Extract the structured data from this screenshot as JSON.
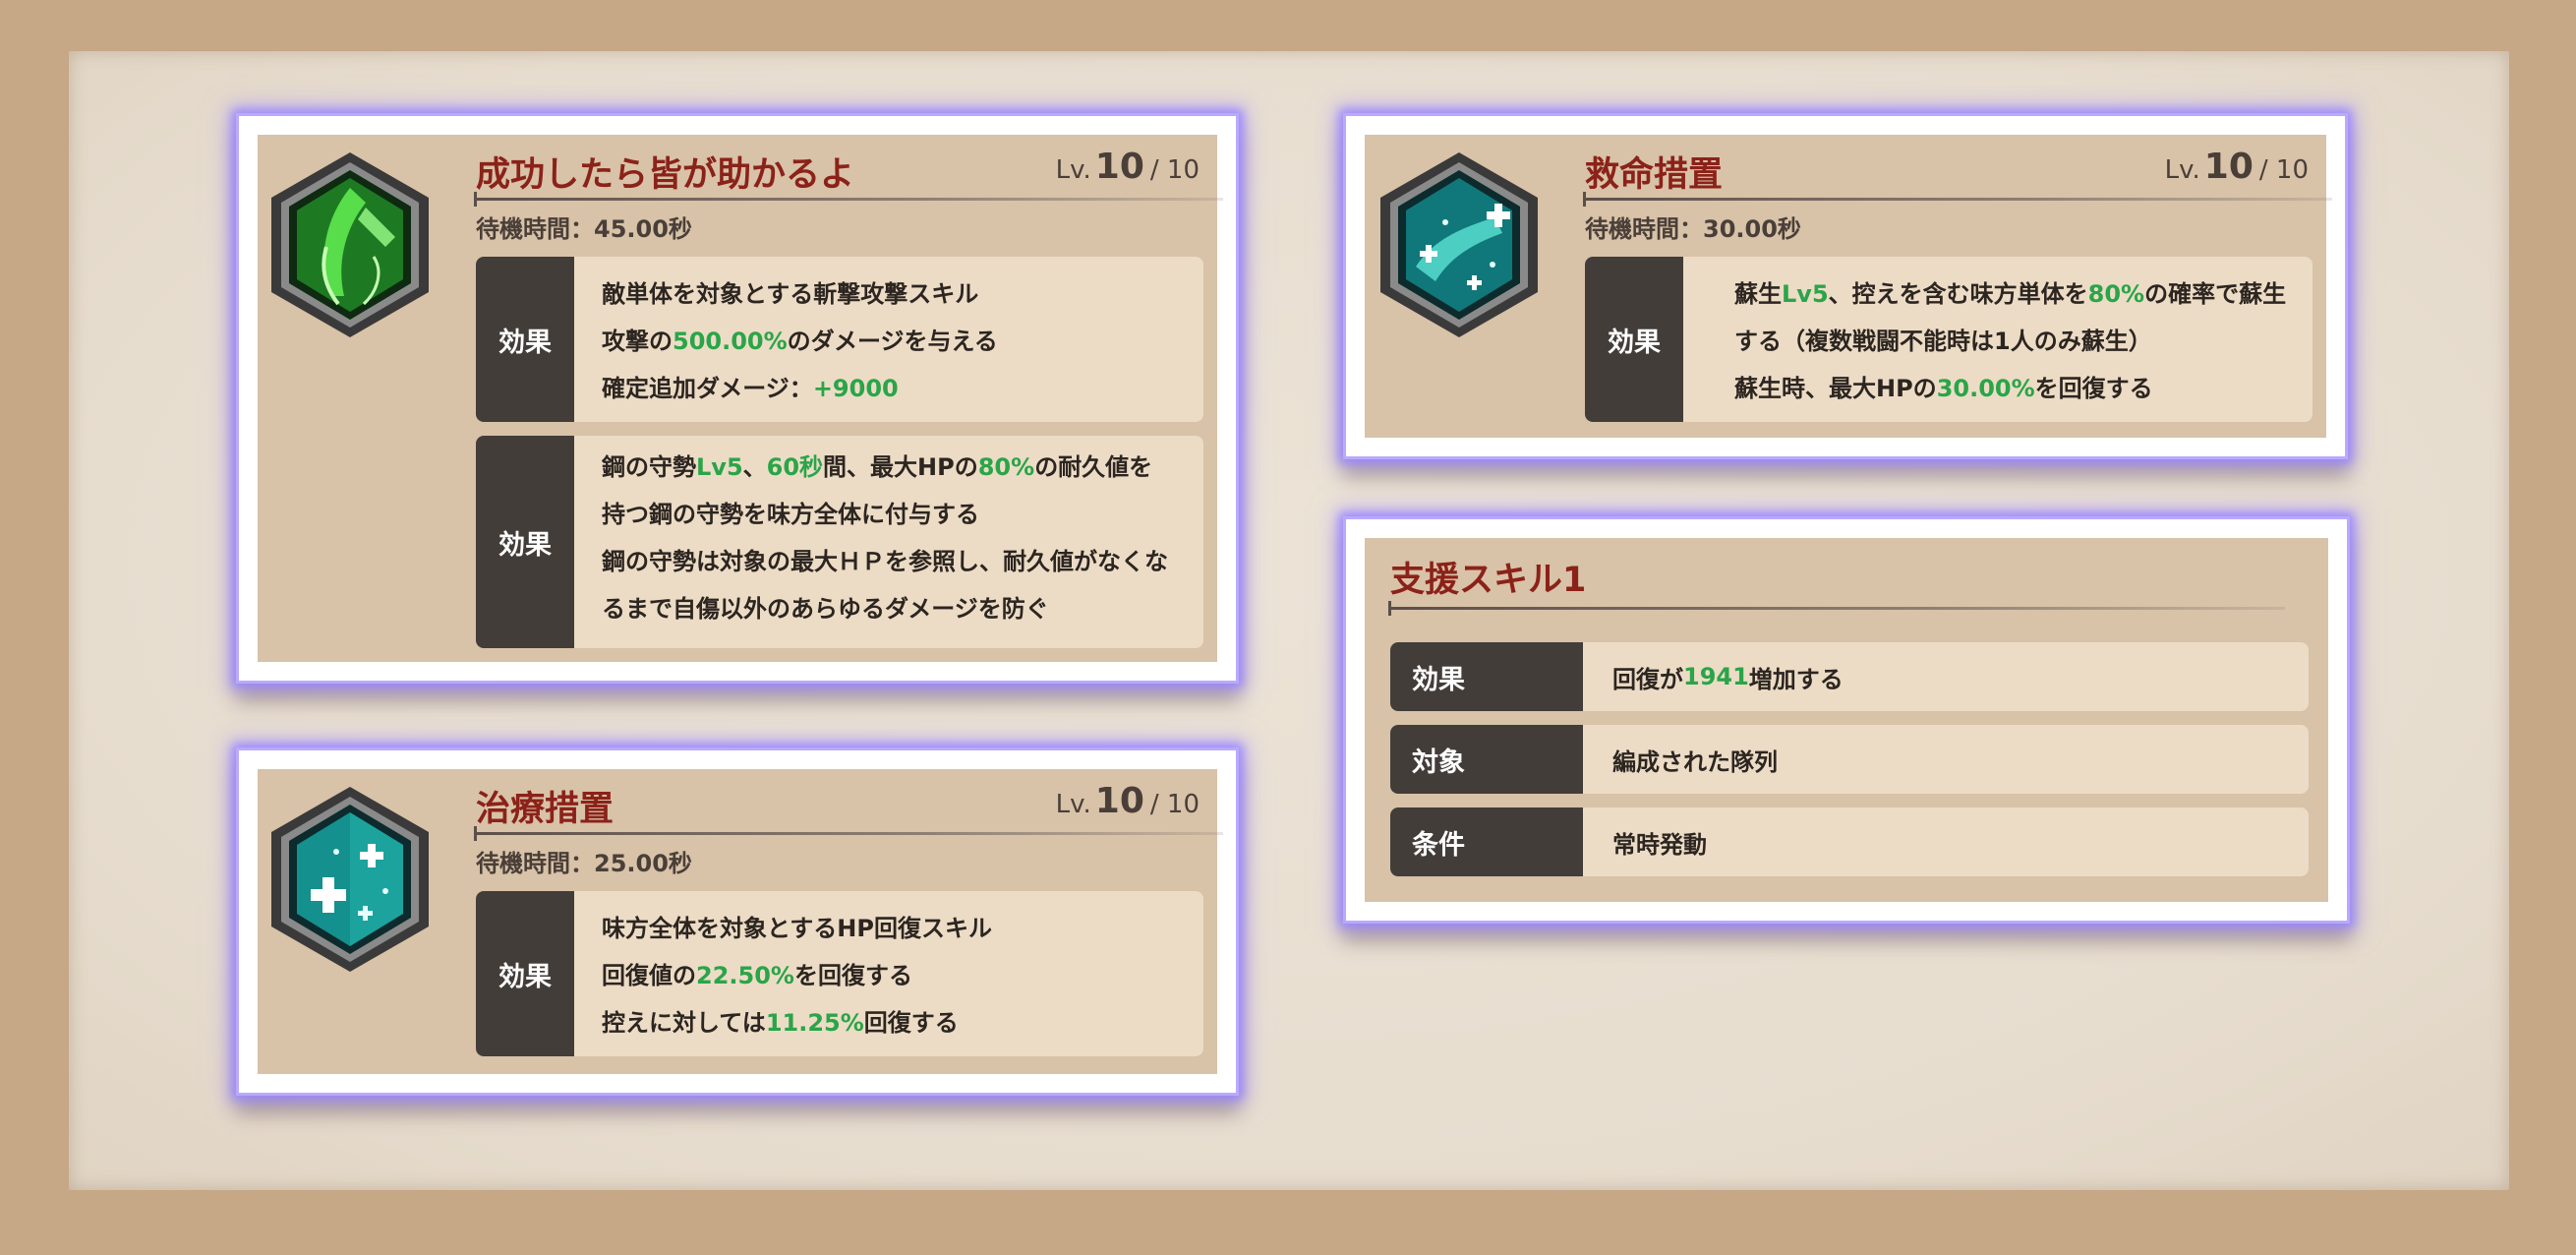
{
  "skills": [
    {
      "name": "成功したら皆が助かるよ",
      "lv_prefix": "Lv.",
      "lv_current": "10",
      "lv_max": "/ 10",
      "cooldown": "待機時間：45.00秒",
      "icon": "sword-slash-icon",
      "effects": [
        {
          "tag": "効果",
          "lines": [
            [
              {
                "t": "敵単体を対象とする斬撃攻撃スキル"
              }
            ],
            [
              {
                "t": "攻撃の"
              },
              {
                "t": "500.00%",
                "g": true
              },
              {
                "t": "のダメージを与える"
              }
            ],
            [
              {
                "t": "確定追加ダメージ："
              },
              {
                "t": "+9000",
                "g": true
              }
            ]
          ]
        },
        {
          "tag": "効果",
          "lines": [
            [
              {
                "t": "鋼の守勢"
              },
              {
                "t": "Lv5",
                "g": true
              },
              {
                "t": "、"
              },
              {
                "t": "60秒",
                "g": true
              },
              {
                "t": "間、最大HPの"
              },
              {
                "t": "80%",
                "g": true
              },
              {
                "t": "の耐久値を"
              }
            ],
            [
              {
                "t": "持つ鋼の守勢を味方全体に付与する"
              }
            ],
            [
              {
                "t": "鋼の守勢は対象の最大ＨＰを参照し、耐久値がなくな"
              }
            ],
            [
              {
                "t": "るまで自傷以外のあらゆるダメージを防ぐ"
              }
            ]
          ]
        }
      ]
    },
    {
      "name": "救命措置",
      "lv_prefix": "Lv.",
      "lv_current": "10",
      "lv_max": "/ 10",
      "cooldown": "待機時間：30.00秒",
      "icon": "revive-hands-icon",
      "effects": [
        {
          "tag": "効果",
          "lines": [
            [
              {
                "t": "蘇生"
              },
              {
                "t": "Lv5",
                "g": true
              },
              {
                "t": "、控えを含む味方単体を"
              },
              {
                "t": "80%",
                "g": true
              },
              {
                "t": "の確率で蘇生"
              }
            ],
            [
              {
                "t": "する（複数戦闘不能時は1人のみ蘇生）"
              }
            ],
            [
              {
                "t": "蘇生時、最大HPの"
              },
              {
                "t": "30.00%",
                "g": true
              },
              {
                "t": "を回復する"
              }
            ]
          ]
        }
      ]
    },
    {
      "name": "治療措置",
      "lv_prefix": "Lv.",
      "lv_current": "10",
      "lv_max": "/ 10",
      "cooldown": "待機時間：25.00秒",
      "icon": "heal-cross-icon",
      "effects": [
        {
          "tag": "効果",
          "lines": [
            [
              {
                "t": "味方全体を対象とするHP回復スキル"
              }
            ],
            [
              {
                "t": "回復値の"
              },
              {
                "t": "22.50%",
                "g": true
              },
              {
                "t": "を回復する"
              }
            ],
            [
              {
                "t": "控えに対しては"
              },
              {
                "t": "11.25%",
                "g": true
              },
              {
                "t": "回復する"
              }
            ]
          ]
        }
      ]
    }
  ],
  "support": {
    "title": "支援スキル1",
    "rows": [
      {
        "tag": "効果",
        "value": [
          {
            "t": "回復が"
          },
          {
            "t": "1941",
            "g": true
          },
          {
            "t": "増加する"
          }
        ]
      },
      {
        "tag": "対象",
        "value": [
          {
            "t": "編成された隊列"
          }
        ]
      },
      {
        "tag": "条件",
        "value": [
          {
            "t": "常時発動"
          }
        ]
      }
    ]
  },
  "colors": {
    "highlight": "#2aa548",
    "title": "#8b2219",
    "tag_bg": "#433d39",
    "card_bg": "#d8c2a8",
    "frame": "#c6a786"
  }
}
